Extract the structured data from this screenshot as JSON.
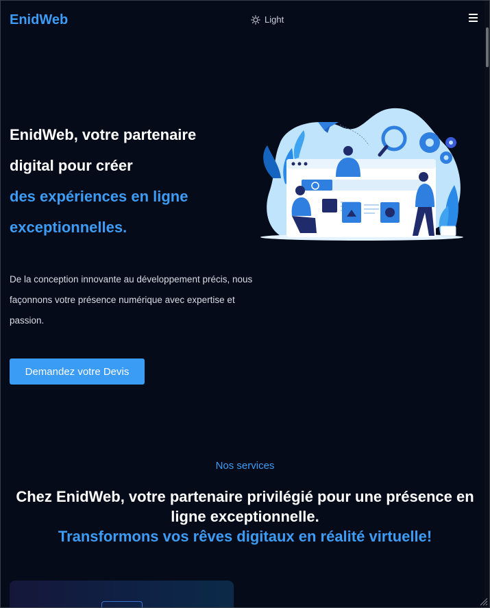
{
  "header": {
    "logo": "EnidWeb",
    "theme_label": "Light",
    "menu_icon": "hamburger-menu-icon",
    "theme_icon": "sun-icon"
  },
  "hero": {
    "title_line1": "EnidWeb, votre partenaire",
    "title_line2": "digital pour créer",
    "title_line3": "des expériences en ligne",
    "title_line4": "exceptionnelles.",
    "description": "De la conception innovante au développement précis, nous façonnons votre présence numérique avec expertise et passion.",
    "cta_label": "Demandez votre Devis"
  },
  "services": {
    "kicker": "Nos services",
    "heading": "Chez EnidWeb, votre partenaire privilégié pour une présence en ligne exceptionnelle.",
    "subheading": "Transformons vos rêves digitaux en réalité virtuelle!"
  },
  "colors": {
    "background": "#060b19",
    "accent": "#3d9cf5",
    "text": "#ffffff"
  }
}
